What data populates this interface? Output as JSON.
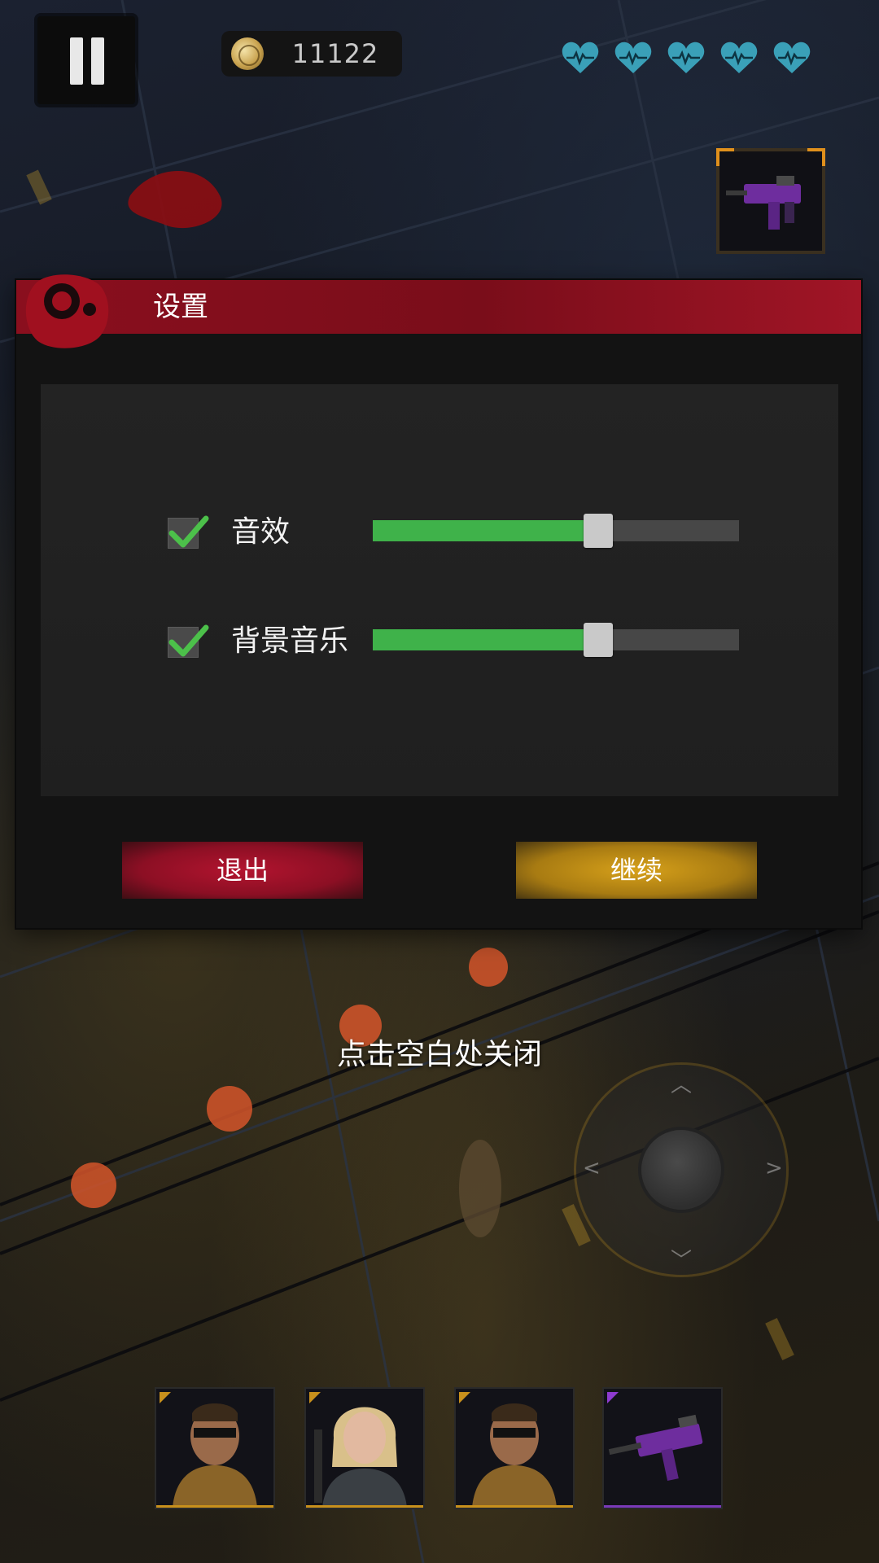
{
  "hud": {
    "coins": "11122",
    "hearts": [
      "heart-icon",
      "heart-icon",
      "heart-icon",
      "heart-icon",
      "heart-icon"
    ],
    "heart_color": "#3aa0b8",
    "equipped_weapon": "smg-icon"
  },
  "settings": {
    "title": "设置",
    "sound_effects": {
      "label": "音效",
      "checked": true,
      "level": 0.58
    },
    "background_music": {
      "label": "背景音乐",
      "checked": true,
      "level": 0.58
    },
    "exit_label": "退出",
    "continue_label": "继续",
    "accent_exit": "#a0132b",
    "accent_continue": "#c8981a",
    "slider_fill": "#3fb24a"
  },
  "close_hint": "点击空白处关闭",
  "team": [
    {
      "icon": "male-soldier-portrait"
    },
    {
      "icon": "female-soldier-portrait"
    },
    {
      "icon": "male-soldier-portrait"
    },
    {
      "icon": "smg-weapon-portrait"
    }
  ]
}
